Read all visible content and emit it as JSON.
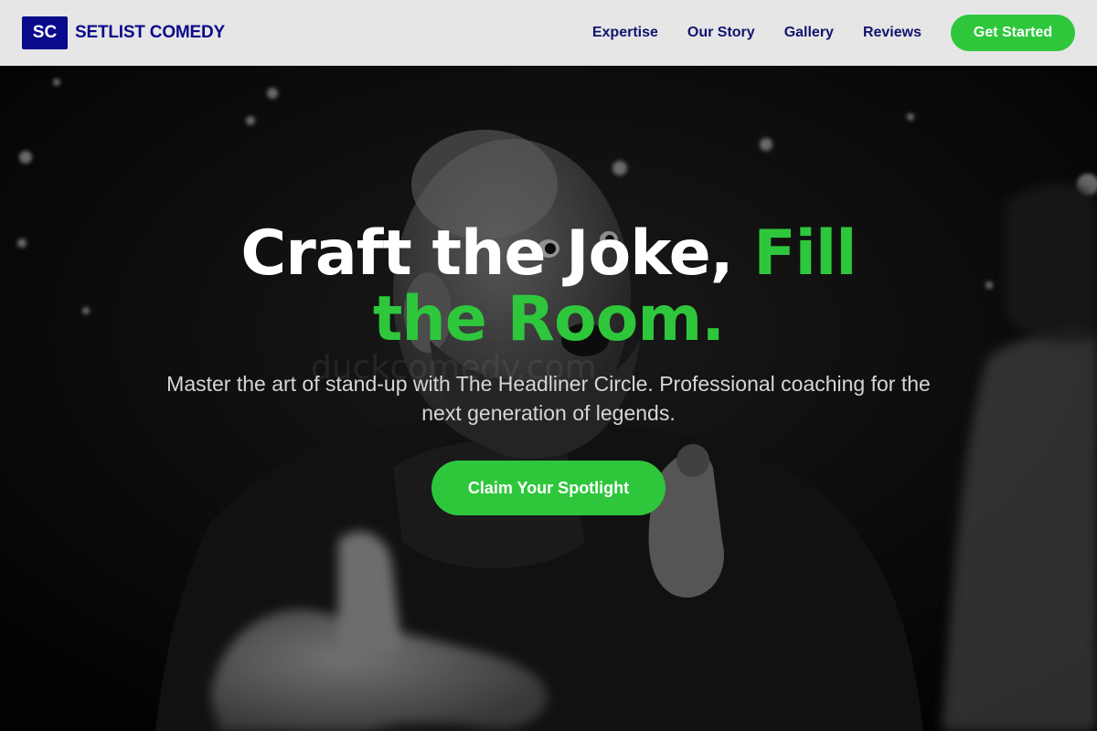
{
  "brand": {
    "badge": "SC",
    "name": "SETLIST COMEDY",
    "color": "#0a0a8c"
  },
  "nav": {
    "links": [
      {
        "label": "Expertise"
      },
      {
        "label": "Our Story"
      },
      {
        "label": "Gallery"
      },
      {
        "label": "Reviews"
      }
    ],
    "cta_label": "Get Started"
  },
  "hero": {
    "headline_white": "Craft the Joke, ",
    "headline_green": "Fill the Room.",
    "subtext": "Master the art of stand-up with The Headliner Circle. Professional coaching for the next generation of legends.",
    "cta_label": "Claim Your Spotlight",
    "watermark": "duckcomedy.com",
    "image": "black-and-white photo of a bearded comedian pointing at the camera"
  },
  "colors": {
    "accent_green": "#2ec73c",
    "nav_background": "#e6e6e6",
    "nav_text": "#12136e"
  }
}
